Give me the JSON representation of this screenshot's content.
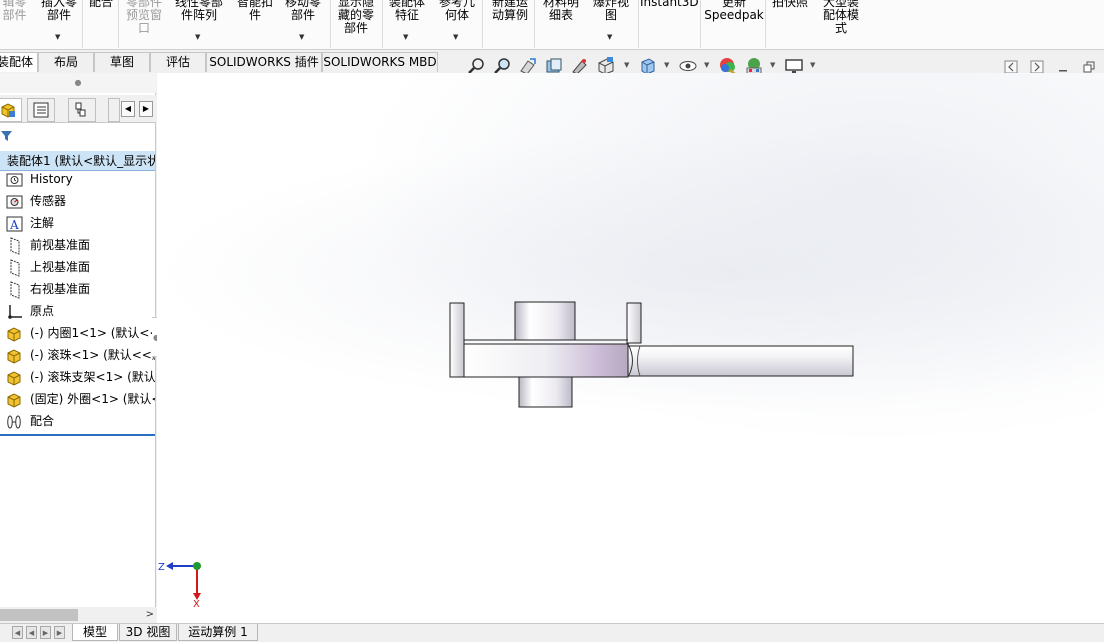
{
  "ribbon": {
    "buttons": [
      {
        "label": "辑零\n部件",
        "disabled": true,
        "dropdown": false
      },
      {
        "label": "插入零\n部件",
        "disabled": false,
        "dropdown": true
      },
      {
        "label": "配合",
        "disabled": false,
        "dropdown": false
      },
      {
        "label": "零部件\n预览窗\n口",
        "disabled": true,
        "dropdown": false
      },
      {
        "label": "线性零部\n件阵列",
        "disabled": false,
        "dropdown": true
      },
      {
        "label": "智能扣\n件",
        "disabled": false,
        "dropdown": false
      },
      {
        "label": "移动零\n部件",
        "disabled": false,
        "dropdown": true
      },
      {
        "label": "显示隐\n藏的零\n部件",
        "disabled": false,
        "dropdown": false
      },
      {
        "label": "装配体\n特征",
        "disabled": false,
        "dropdown": true
      },
      {
        "label": "参考几\n何体",
        "disabled": false,
        "dropdown": true
      },
      {
        "label": "新建运\n动算例",
        "disabled": false,
        "dropdown": false
      },
      {
        "label": "材料明\n细表",
        "disabled": false,
        "dropdown": false
      },
      {
        "label": "爆炸视\n图",
        "disabled": false,
        "dropdown": true
      },
      {
        "label": "Instant3D",
        "disabled": false,
        "dropdown": false
      },
      {
        "label": "更新\nSpeedpak",
        "disabled": false,
        "dropdown": false
      },
      {
        "label": "拍快照",
        "disabled": false,
        "dropdown": false
      },
      {
        "label": "大型装\n配体模\n式",
        "disabled": false,
        "dropdown": false
      }
    ]
  },
  "command_tabs": [
    "装配体",
    "布局",
    "草图",
    "评估",
    "SOLIDWORKS 插件",
    "SOLIDWORKS MBD"
  ],
  "view_toolbar_icons": [
    "zoom-to-fit-icon",
    "zoom-to-area-icon",
    "previous-view-icon",
    "section-view-icon",
    "dynamic-annotation-icon",
    "view-orientation-icon",
    "display-style-icon",
    "hide-show-items-icon",
    "edit-appearance-icon",
    "apply-scene-icon",
    "view-settings-icon"
  ],
  "feature_tree": {
    "filter_icon": "filter-icon",
    "root": "装配体1 (默认<默认_显示状",
    "items": [
      {
        "label": "History",
        "icon": "history-icon"
      },
      {
        "label": "传感器",
        "icon": "sensor-icon"
      },
      {
        "label": "注解",
        "icon": "annotation-icon"
      },
      {
        "label": "前视基准面",
        "icon": "plane-icon"
      },
      {
        "label": "上视基准面",
        "icon": "plane-icon"
      },
      {
        "label": "右视基准面",
        "icon": "plane-icon"
      },
      {
        "label": "原点",
        "icon": "origin-icon"
      },
      {
        "label": "(-) 内圈1<1> (默认<<",
        "icon": "part-icon"
      },
      {
        "label": "(-) 滚珠<1> (默认<<默",
        "icon": "part-icon"
      },
      {
        "label": "(-) 滚珠支架<1> (默认",
        "icon": "part-icon"
      },
      {
        "label": "(固定) 外圈<1> (默认<",
        "icon": "part-icon"
      },
      {
        "label": "配合",
        "icon": "mates-icon"
      }
    ]
  },
  "triad": {
    "z_label": "Z",
    "x_label": "X"
  },
  "bottom_tabs": [
    "模型",
    "3D 视图",
    "运动算例 1"
  ]
}
